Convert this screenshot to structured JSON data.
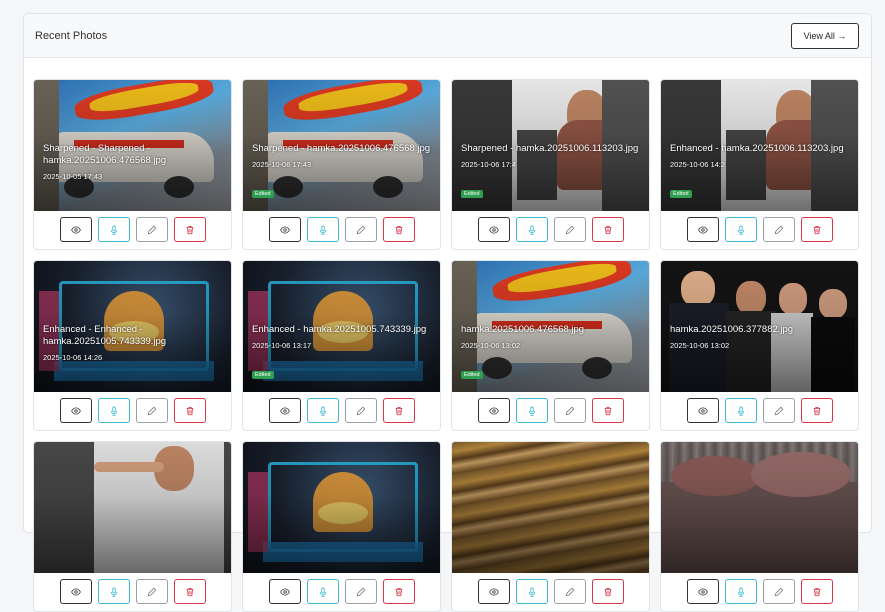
{
  "header": {
    "title": "Recent Photos",
    "view_all_label": "View All →"
  },
  "photos": [
    {
      "name": "Sharpened - Sharpened - hamka.20251006.476568.jpg",
      "date": "2025-10-05 17:43",
      "edited": "",
      "theme": "car"
    },
    {
      "name": "Sharpened - hamka.20251006.476568.jpg",
      "date": "2025-10-06 17:43",
      "edited": "Edited",
      "theme": "car"
    },
    {
      "name": "Sharpened - hamka.20251006.113203.jpg",
      "date": "2025-10-06 17:4",
      "edited": "Edited",
      "theme": "boy"
    },
    {
      "name": "Enhanced - hamka.20251006.113203.jpg",
      "date": "2025-10-06 14:2",
      "edited": "Edited",
      "theme": "boy"
    },
    {
      "name": "Enhanced - Enhanced - hamka.20251005.743339.jpg",
      "date": "2025-10-06 14:26",
      "edited": "",
      "theme": "neon"
    },
    {
      "name": "Enhanced - hamka.20251005.743339.jpg",
      "date": "2025-10-06 13:17",
      "edited": "Edited",
      "theme": "neon"
    },
    {
      "name": "hamka.20251006.476568.jpg",
      "date": "2025-10-06 13:02",
      "edited": "Edited",
      "theme": "car"
    },
    {
      "name": "hamka.20251006.377882.jpg",
      "date": "2025-10-06 13:02",
      "edited": "",
      "theme": "people"
    },
    {
      "name": "",
      "date": "",
      "edited": "",
      "theme": "boy2"
    },
    {
      "name": "",
      "date": "",
      "edited": "",
      "theme": "neon"
    },
    {
      "name": "",
      "date": "",
      "edited": "",
      "theme": "pipes"
    },
    {
      "name": "",
      "date": "",
      "edited": "",
      "theme": "rust"
    }
  ],
  "actions": {
    "view": "eye-icon",
    "voice": "microphone-icon",
    "edit": "pencil-icon",
    "delete": "trash-icon"
  },
  "colors": {
    "view": "#333333",
    "voice": "#39b7cf",
    "edit": "#9aa0a6",
    "delete": "#dc3545",
    "edited_badge": "#2e9e4f"
  }
}
